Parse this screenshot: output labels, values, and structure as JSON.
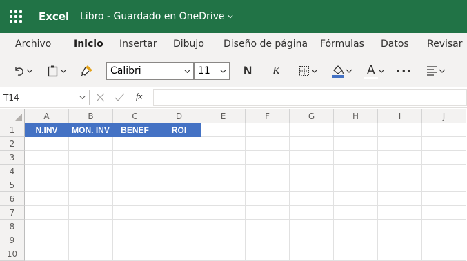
{
  "titlebar": {
    "app": "Excel",
    "doc_title": "Libro  -  Guardado en OneDrive",
    "color": "#217346"
  },
  "tabs": [
    "Archivo",
    "Inicio",
    "Insertar",
    "Dibujo",
    "Diseño de página",
    "Fórmulas",
    "Datos",
    "Revisar"
  ],
  "active_tab": "Inicio",
  "toolbar": {
    "font": "Calibri",
    "size": "11",
    "bold": "N",
    "italic": "K",
    "font_color_glyph": "A",
    "more": "···",
    "icons": [
      "undo-icon",
      "paste-icon",
      "format-painter-icon",
      "borders-icon",
      "fill-color-icon",
      "font-color-icon",
      "more-icon",
      "align-icon"
    ]
  },
  "formula_bar": {
    "name_box": "T14",
    "fx": "fx",
    "value": ""
  },
  "sheet": {
    "columns": [
      "A",
      "B",
      "C",
      "D",
      "E",
      "F",
      "G",
      "H",
      "I",
      "J"
    ],
    "rows": [
      "1",
      "2",
      "3",
      "4",
      "5",
      "6",
      "7",
      "8",
      "9",
      "10"
    ],
    "header_cells": [
      "N.INV",
      "MON. INV",
      "BENEF",
      "ROI"
    ],
    "header_fill": "#4472c4"
  }
}
